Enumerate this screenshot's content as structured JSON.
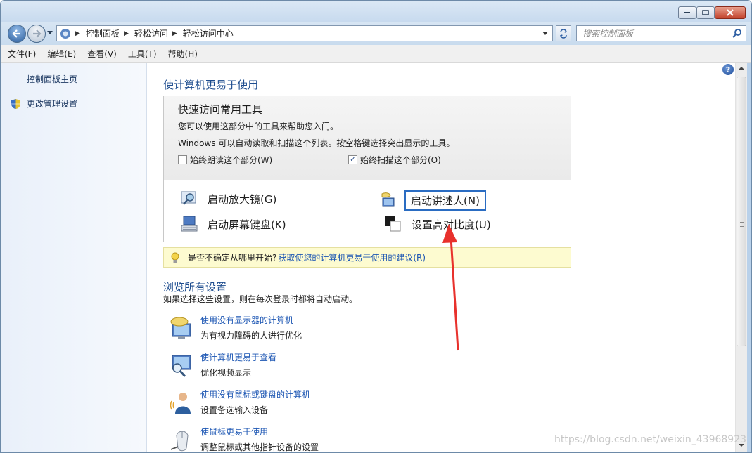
{
  "window": {
    "minimize_icon": "minimize-icon",
    "maximize_icon": "maximize-icon",
    "close_icon": "close-icon"
  },
  "address_bar": {
    "breadcrumbs": [
      "控制面板",
      "轻松访问",
      "轻松访问中心"
    ],
    "search_placeholder": "搜索控制面板"
  },
  "menu": [
    "文件(F)",
    "编辑(E)",
    "查看(V)",
    "工具(T)",
    "帮助(H)"
  ],
  "sidebar": {
    "home_link": "控制面板主页",
    "admin_link": "更改管理设置"
  },
  "main": {
    "heading": "使计算机更易于使用",
    "quick_access": {
      "title": "快速访问常用工具",
      "line1": "您可以使用这部分中的工具来帮助您入门。",
      "line2": "Windows 可以自动读取和扫描这个列表。按空格键选择突出显示的工具。",
      "checkbox_read": {
        "label": "始终朗读这个部分(W)",
        "checked": false
      },
      "checkbox_scan": {
        "label": "始终扫描这个部分(O)",
        "checked": true
      },
      "tools": {
        "magnifier": "启动放大镜(G)",
        "narrator": "启动讲述人(N)",
        "keyboard": "启动屏幕键盘(K)",
        "contrast": "设置高对比度(U)"
      }
    },
    "tip": {
      "text": "是否不确定从哪里开始?",
      "link": "获取使您的计算机更易于使用的建议(R)"
    },
    "browse": {
      "heading": "浏览所有设置",
      "sub": "如果选择这些设置，则在每次登录时都将自动启动。",
      "items": [
        {
          "link": "使用没有显示器的计算机",
          "desc": "为有视力障碍的人进行优化"
        },
        {
          "link": "使计算机更易于查看",
          "desc": "优化视频显示"
        },
        {
          "link": "使用没有鼠标或键盘的计算机",
          "desc": "设置备选输入设备"
        },
        {
          "link": "使鼠标更易于使用",
          "desc": "调整鼠标或其他指针设备的设置"
        }
      ]
    }
  },
  "watermark": "https://blog.csdn.net/weixin_43968923",
  "colors": {
    "link": "#1c56b3",
    "heading": "#1e4d8f",
    "annotation_arrow": "#e8312c",
    "highlight_box": "#2a6cc2"
  }
}
